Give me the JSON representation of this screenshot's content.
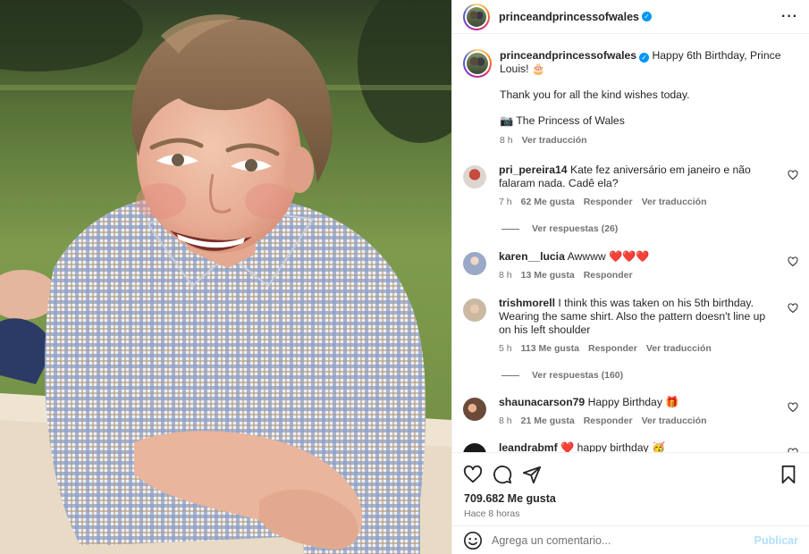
{
  "post": {
    "username": "princeandprincessofwales",
    "image_alt": "Portrait photo of a smiling boy in a checked shirt lying on a blanket in a garden"
  },
  "caption": {
    "username": "princeandprincessofwales",
    "text": "Happy 6th Birthday, Prince Louis! 🎂",
    "line2": "Thank you for all the kind wishes today.",
    "line3": "📷 The Princess of Wales",
    "time": "8 h",
    "translate": "Ver traducción"
  },
  "comments": [
    {
      "username": "pri_pereira14",
      "text": "Kate fez aniversário em janeiro e não falaram nada. Cadê ela?",
      "time": "7 h",
      "likes": "62 Me gusta",
      "reply": "Responder",
      "translate": "Ver traducción",
      "replies": "Ver respuestas (26)",
      "avatar_color": "#b5443c"
    },
    {
      "username": "karen__lucia",
      "text": "Awwww ❤️❤️❤️",
      "time": "8 h",
      "likes": "13 Me gusta",
      "reply": "Responder",
      "avatar_color": "#9aa9c8"
    },
    {
      "username": "trishmorell",
      "text": "I think this was taken on his 5th birthday. Wearing the same shirt. Also the pattern doesn't line up on his left shoulder",
      "time": "5 h",
      "likes": "113 Me gusta",
      "reply": "Responder",
      "translate": "Ver traducción",
      "replies": "Ver respuestas (160)",
      "avatar_color": "#c9b9a2"
    },
    {
      "username": "shaunacarson79",
      "text": "Happy Birthday 🎁",
      "time": "8 h",
      "likes": "21 Me gusta",
      "reply": "Responder",
      "translate": "Ver traducción",
      "avatar_color": "#6b4a3a"
    },
    {
      "username": "leandrabmf",
      "text": "❤️ happy birthday 🥳",
      "avatar_color": "#1a1a1a"
    }
  ],
  "actions": {
    "likes": "709.682 Me gusta",
    "when": "Hace 8 horas",
    "comment_placeholder": "Agrega un comentario...",
    "publish": "Publicar"
  },
  "colors": {
    "link_blue": "#0095f6",
    "muted": "#737373",
    "publish_disabled": "#b2dffc"
  }
}
